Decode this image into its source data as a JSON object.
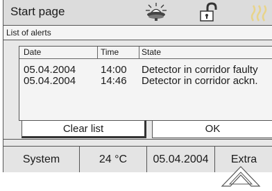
{
  "header": {
    "title": "Start page",
    "icons": [
      "lamp-icon",
      "unlocked-padlock-icon",
      "heating-icon"
    ]
  },
  "panel": {
    "title": "List of alerts"
  },
  "alerts": {
    "columns": {
      "date": "Date",
      "time": "Time",
      "state": "State"
    },
    "rows": [
      {
        "date": "05.04.2004",
        "time": "14:00",
        "state": "Detector in corridor faulty"
      },
      {
        "date": "05.04.2004",
        "time": "14:46",
        "state": "Detector in corridor ackn."
      }
    ]
  },
  "buttons": {
    "clear": "Clear list",
    "ok": "OK"
  },
  "statusbar": {
    "system": "System",
    "temperature": "24 °C",
    "date": "05.04.2004",
    "extra": "Extra"
  },
  "colors": {
    "background": "#e8e8e8",
    "button": "#ffffff",
    "border": "#555555"
  }
}
